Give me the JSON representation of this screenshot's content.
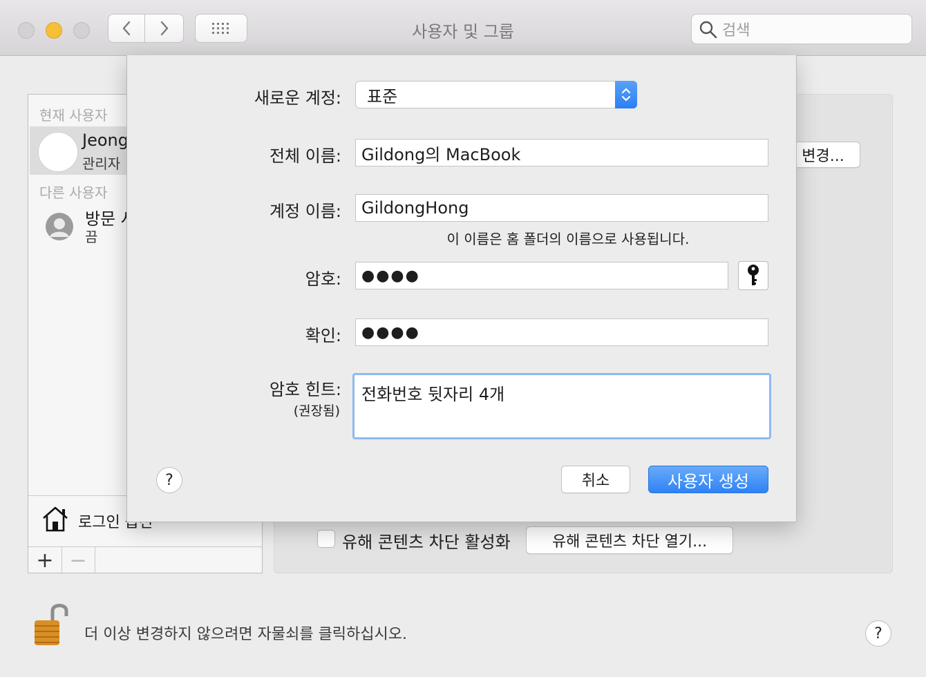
{
  "window": {
    "title": "사용자 및 그룹"
  },
  "search": {
    "placeholder": "검색"
  },
  "users_panel": {
    "current_section": "현재 사용자",
    "current_user": {
      "name": "Jeong",
      "role": "관리자"
    },
    "other_section": "다른 사용자",
    "other_user": {
      "name": "방문 사",
      "status": "끔"
    },
    "login_options": "로그인 옵션",
    "add_label": "+",
    "remove_label": "−"
  },
  "right_panel": {
    "change_button": "변경...",
    "parental_checkbox_label": "유해 콘텐츠 차단 활성화",
    "parental_open_button": "유해 콘텐츠 차단 열기..."
  },
  "footer": {
    "lock_text": "더 이상 변경하지 않으려면 자물쇠를 클릭하십시오.",
    "help": "?"
  },
  "sheet": {
    "new_account_label": "새로운 계정:",
    "new_account_value": "표준",
    "full_name_label": "전체 이름:",
    "full_name_value": "Gildong의 MacBook",
    "account_name_label": "계정 이름:",
    "account_name_value": "GildongHong",
    "account_name_note": "이 이름은 홈 폴더의 이름으로 사용됩니다.",
    "password_label": "암호:",
    "password_value": "●●●●",
    "verify_label": "확인:",
    "verify_value": "●●●●",
    "hint_label": "암호 힌트:",
    "hint_sublabel": "(권장됨)",
    "hint_value": "전화번호 뒷자리 4개",
    "help": "?",
    "cancel_button": "취소",
    "create_button": "사용자 생성"
  }
}
